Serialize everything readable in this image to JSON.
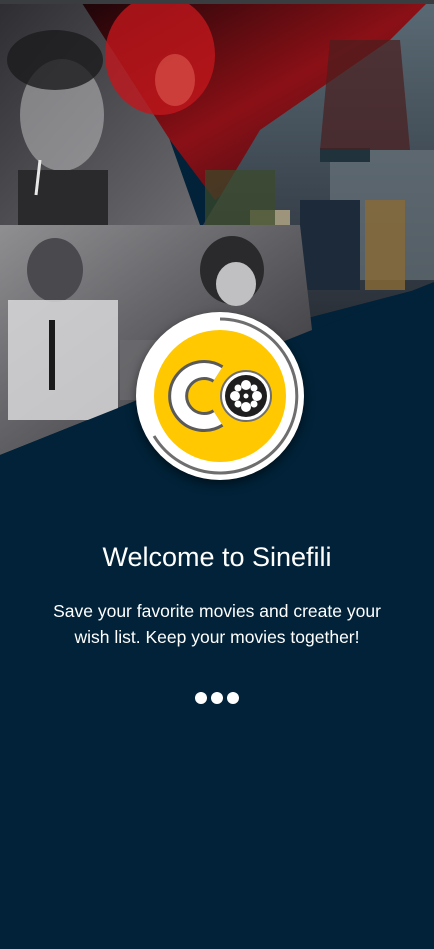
{
  "onboarding": {
    "title": "Welcome to Sinefili",
    "description": "Save your favorite movies and create your wish list. Keep your movies together!",
    "page_indicator": {
      "count": 3
    }
  },
  "logo": {
    "name": "sinefili-logo",
    "icon": "film-reel-icon"
  },
  "colors": {
    "background": "#012238",
    "accent": "#FFC800",
    "text": "#FFFFFF"
  }
}
